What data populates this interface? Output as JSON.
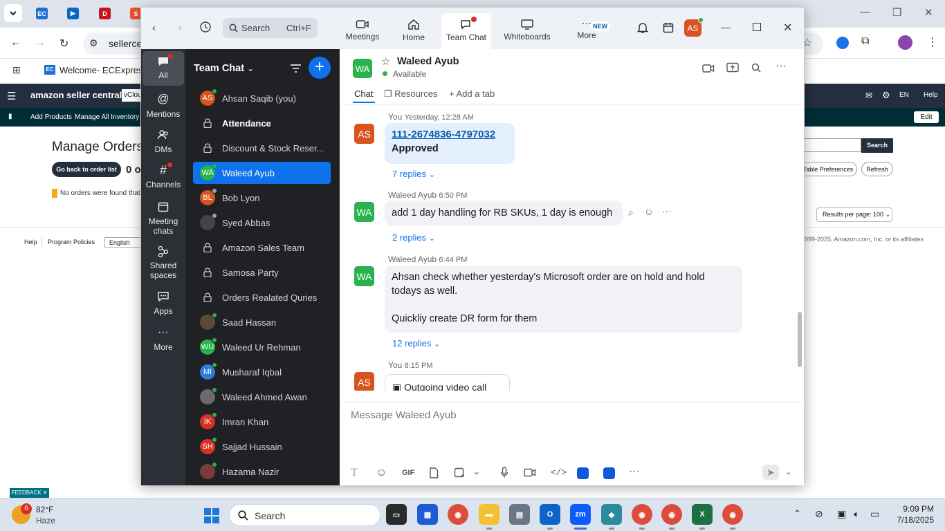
{
  "browser": {
    "omnibox_text": "sellerce",
    "bookmark": "Welcome- ECExpres"
  },
  "amazon": {
    "brand": "amazon seller central",
    "store": "vClou",
    "header_links": [
      "EN",
      "Help"
    ],
    "nav_items": [
      "Add Products",
      "Manage All Inventory"
    ],
    "edit_label": "Edit",
    "page_title": "Manage Orders",
    "back_button": "Go back to order list",
    "orders_count": "0 o",
    "no_orders_text": "No orders were found that r",
    "search_label": "Search",
    "table_prefs": "Table Preferences",
    "refresh": "Refresh",
    "results_per_page": "Results per page: 100",
    "footer_links": [
      "Help",
      "Program Policies"
    ],
    "language": "English",
    "copyright": "999-2025, Amazon.com, Inc. or its affiliates",
    "feedback": "FEEDBACK"
  },
  "zoom": {
    "search_placeholder": "Search",
    "search_shortcut": "Ctrl+F",
    "tabs": [
      {
        "label": "Meetings"
      },
      {
        "label": "Home"
      },
      {
        "label": "Team Chat"
      },
      {
        "label": "Whiteboards"
      },
      {
        "label": "More",
        "badge": "NEW"
      }
    ],
    "profile_initials": "AS",
    "rail": [
      {
        "label": "All"
      },
      {
        "label": "Mentions"
      },
      {
        "label": "DMs"
      },
      {
        "label": "Channels"
      },
      {
        "label": "Meeting chats"
      },
      {
        "label": "Shared spaces"
      },
      {
        "label": "Apps"
      },
      {
        "label": "More"
      }
    ],
    "list_title": "Team Chat",
    "contacts": [
      {
        "name": "Ahsan Saqib (you)",
        "initials": "AS",
        "color": "#d9531e",
        "status": "#2bb24c",
        "type": "person"
      },
      {
        "name": "Attendance",
        "type": "channel",
        "bold": true
      },
      {
        "name": "Discount & Stock Reser...",
        "type": "channel"
      },
      {
        "name": "Waleed Ayub",
        "initials": "WA",
        "color": "#2bb24c",
        "status": "#2bb24c",
        "type": "person",
        "selected": true
      },
      {
        "name": "Bob Lyon",
        "initials": "BL",
        "color": "#d9531e",
        "status": "#9aa0a6",
        "type": "person"
      },
      {
        "name": "Syed Abbas",
        "initials": "",
        "color": "#444",
        "status": "#9aa0a6",
        "type": "photo"
      },
      {
        "name": "Amazon Sales Team",
        "type": "channel"
      },
      {
        "name": "Samosa Party",
        "type": "channel"
      },
      {
        "name": "Orders Realated Quries",
        "type": "channel"
      },
      {
        "name": "Saad Hassan",
        "initials": "",
        "color": "#5a4a3a",
        "status": "#2bb24c",
        "type": "photo"
      },
      {
        "name": "Waleed Ur Rehman",
        "initials": "WU",
        "color": "#2bb24c",
        "status": "#2bb24c",
        "type": "person"
      },
      {
        "name": "Musharaf Iqbal",
        "initials": "MI",
        "color": "#2e7dd7",
        "status": "#2bb24c",
        "type": "person"
      },
      {
        "name": "Waleed Ahmed Awan",
        "initials": "",
        "color": "#6b6b6b",
        "status": "#2bb24c",
        "type": "photo"
      },
      {
        "name": "Imran Khan",
        "initials": "IK",
        "color": "#d93025",
        "status": "#2bb24c",
        "type": "person"
      },
      {
        "name": "Sajjad Hussain",
        "initials": "SH",
        "color": "#d93025",
        "status": "#2bb24c",
        "type": "person"
      },
      {
        "name": "Hazama Nazir",
        "initials": "",
        "color": "#7a3b3b",
        "status": "#2bb24c",
        "type": "photo"
      }
    ],
    "chat": {
      "contact_name": "Waleed Ayub",
      "contact_initials": "WA",
      "contact_status": "Available",
      "tabs": [
        "Chat",
        "Resources",
        "Add a tab"
      ],
      "messages": [
        {
          "initials": "AS",
          "sender": "You",
          "time": "Yesterday, 12:28 AM",
          "link": "111-2674836-4797032",
          "line2": "Approved",
          "replies": "7 replies"
        },
        {
          "initials": "WA",
          "sender": "Waleed Ayub",
          "time": "6:50 PM",
          "text": "add 1 day handling for RB SKUs, 1 day is enough",
          "replies": "2 replies"
        },
        {
          "initials": "WA",
          "sender": "Waleed Ayub",
          "time": "6:44 PM",
          "text": "Ahsan check whether yesterday's Microsoft order are on hold and hold todays as well.",
          "text2": "Quickliy create DR form for them",
          "replies": "12 replies"
        },
        {
          "initials": "AS",
          "sender": "You",
          "time": "8:15 PM",
          "text": "Outgoing video call"
        }
      ],
      "compose_placeholder": "Message Waleed Ayub",
      "gif_label": "GIF"
    }
  },
  "taskbar": {
    "weather_temp": "82°F",
    "weather_desc": "Haze",
    "weather_badge": "6",
    "search_label": "Search",
    "time": "9:09 PM",
    "date": "7/18/2025"
  }
}
